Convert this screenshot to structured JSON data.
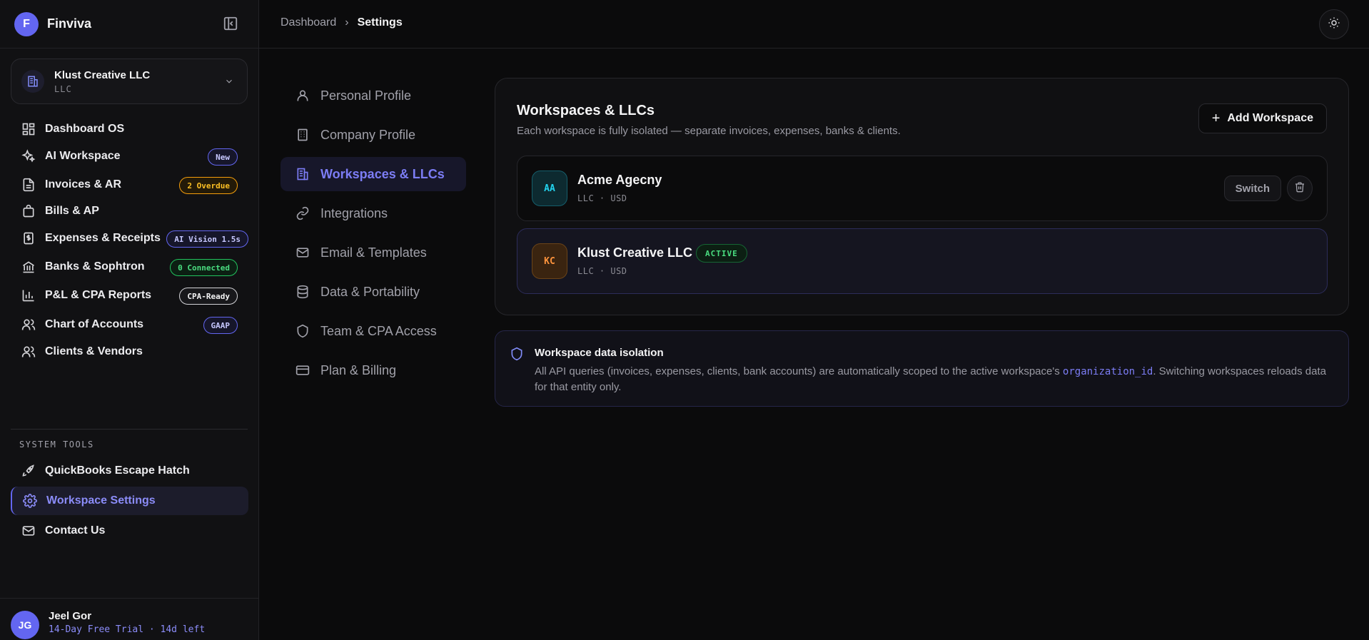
{
  "brand": {
    "initial": "F",
    "name": "Finviva"
  },
  "org": {
    "name": "Klust Creative LLC",
    "type": "LLC"
  },
  "sidebar": {
    "items": [
      {
        "label": "Dashboard OS",
        "icon": "grid-icon"
      },
      {
        "label": "AI Workspace",
        "icon": "sparkles-icon",
        "badge": "New"
      },
      {
        "label": "Invoices & AR",
        "icon": "file-icon",
        "badge": "2 Overdue"
      },
      {
        "label": "Bills & AP",
        "icon": "bag-icon"
      },
      {
        "label": "Expenses & Receipts",
        "icon": "receipt-icon",
        "badge": "AI Vision 1.5s"
      },
      {
        "label": "Banks & Sophtron",
        "icon": "bank-icon",
        "badge": "0 Connected"
      },
      {
        "label": "P&L & CPA Reports",
        "icon": "bar-chart-icon",
        "badge": "CPA-Ready"
      },
      {
        "label": "Chart of Accounts",
        "icon": "users-icon",
        "badge": "GAAP"
      },
      {
        "label": "Clients & Vendors",
        "icon": "users-icon"
      }
    ],
    "section_label": "SYSTEM TOOLS",
    "tools": [
      {
        "label": "QuickBooks Escape Hatch",
        "icon": "rocket-icon"
      },
      {
        "label": "Workspace Settings",
        "icon": "gear-icon"
      },
      {
        "label": "Contact Us",
        "icon": "mail-icon"
      }
    ]
  },
  "user": {
    "initials": "JG",
    "name": "Jeel Gor",
    "trial": "14-Day Free Trial · 14d left"
  },
  "breadcrumb": {
    "parent": "Dashboard",
    "separator": "›",
    "current": "Settings"
  },
  "settings_nav": [
    {
      "label": "Personal Profile",
      "icon": "user-icon"
    },
    {
      "label": "Company Profile",
      "icon": "building-icon"
    },
    {
      "label": "Workspaces & LLCs",
      "icon": "buildings-icon"
    },
    {
      "label": "Integrations",
      "icon": "link-icon"
    },
    {
      "label": "Email & Templates",
      "icon": "mail-icon"
    },
    {
      "label": "Data & Portability",
      "icon": "database-icon"
    },
    {
      "label": "Team & CPA Access",
      "icon": "shield-icon"
    },
    {
      "label": "Plan & Billing",
      "icon": "card-icon"
    }
  ],
  "panel": {
    "title": "Workspaces & LLCs",
    "subtitle": "Each workspace is fully isolated — separate invoices, expenses, banks & clients.",
    "add_label": "Add Workspace",
    "workspaces": [
      {
        "initials": "AA",
        "name": "Acme Agecny",
        "meta": "LLC · USD",
        "switch_label": "Switch"
      },
      {
        "initials": "KC",
        "name": "Klust Creative LLC",
        "meta": "LLC · USD",
        "active_label": "ACTIVE"
      }
    ]
  },
  "info": {
    "title": "Workspace data isolation",
    "body_before": "All API queries (invoices, expenses, clients, bank accounts) are automatically scoped to the active workspace's ",
    "code": "organization_id",
    "body_after": ". Switching workspaces reloads data for that entity only."
  },
  "colors": {
    "accent": "#6366f1",
    "active_green": "#4ade80",
    "overdue": "#fbbf24"
  }
}
